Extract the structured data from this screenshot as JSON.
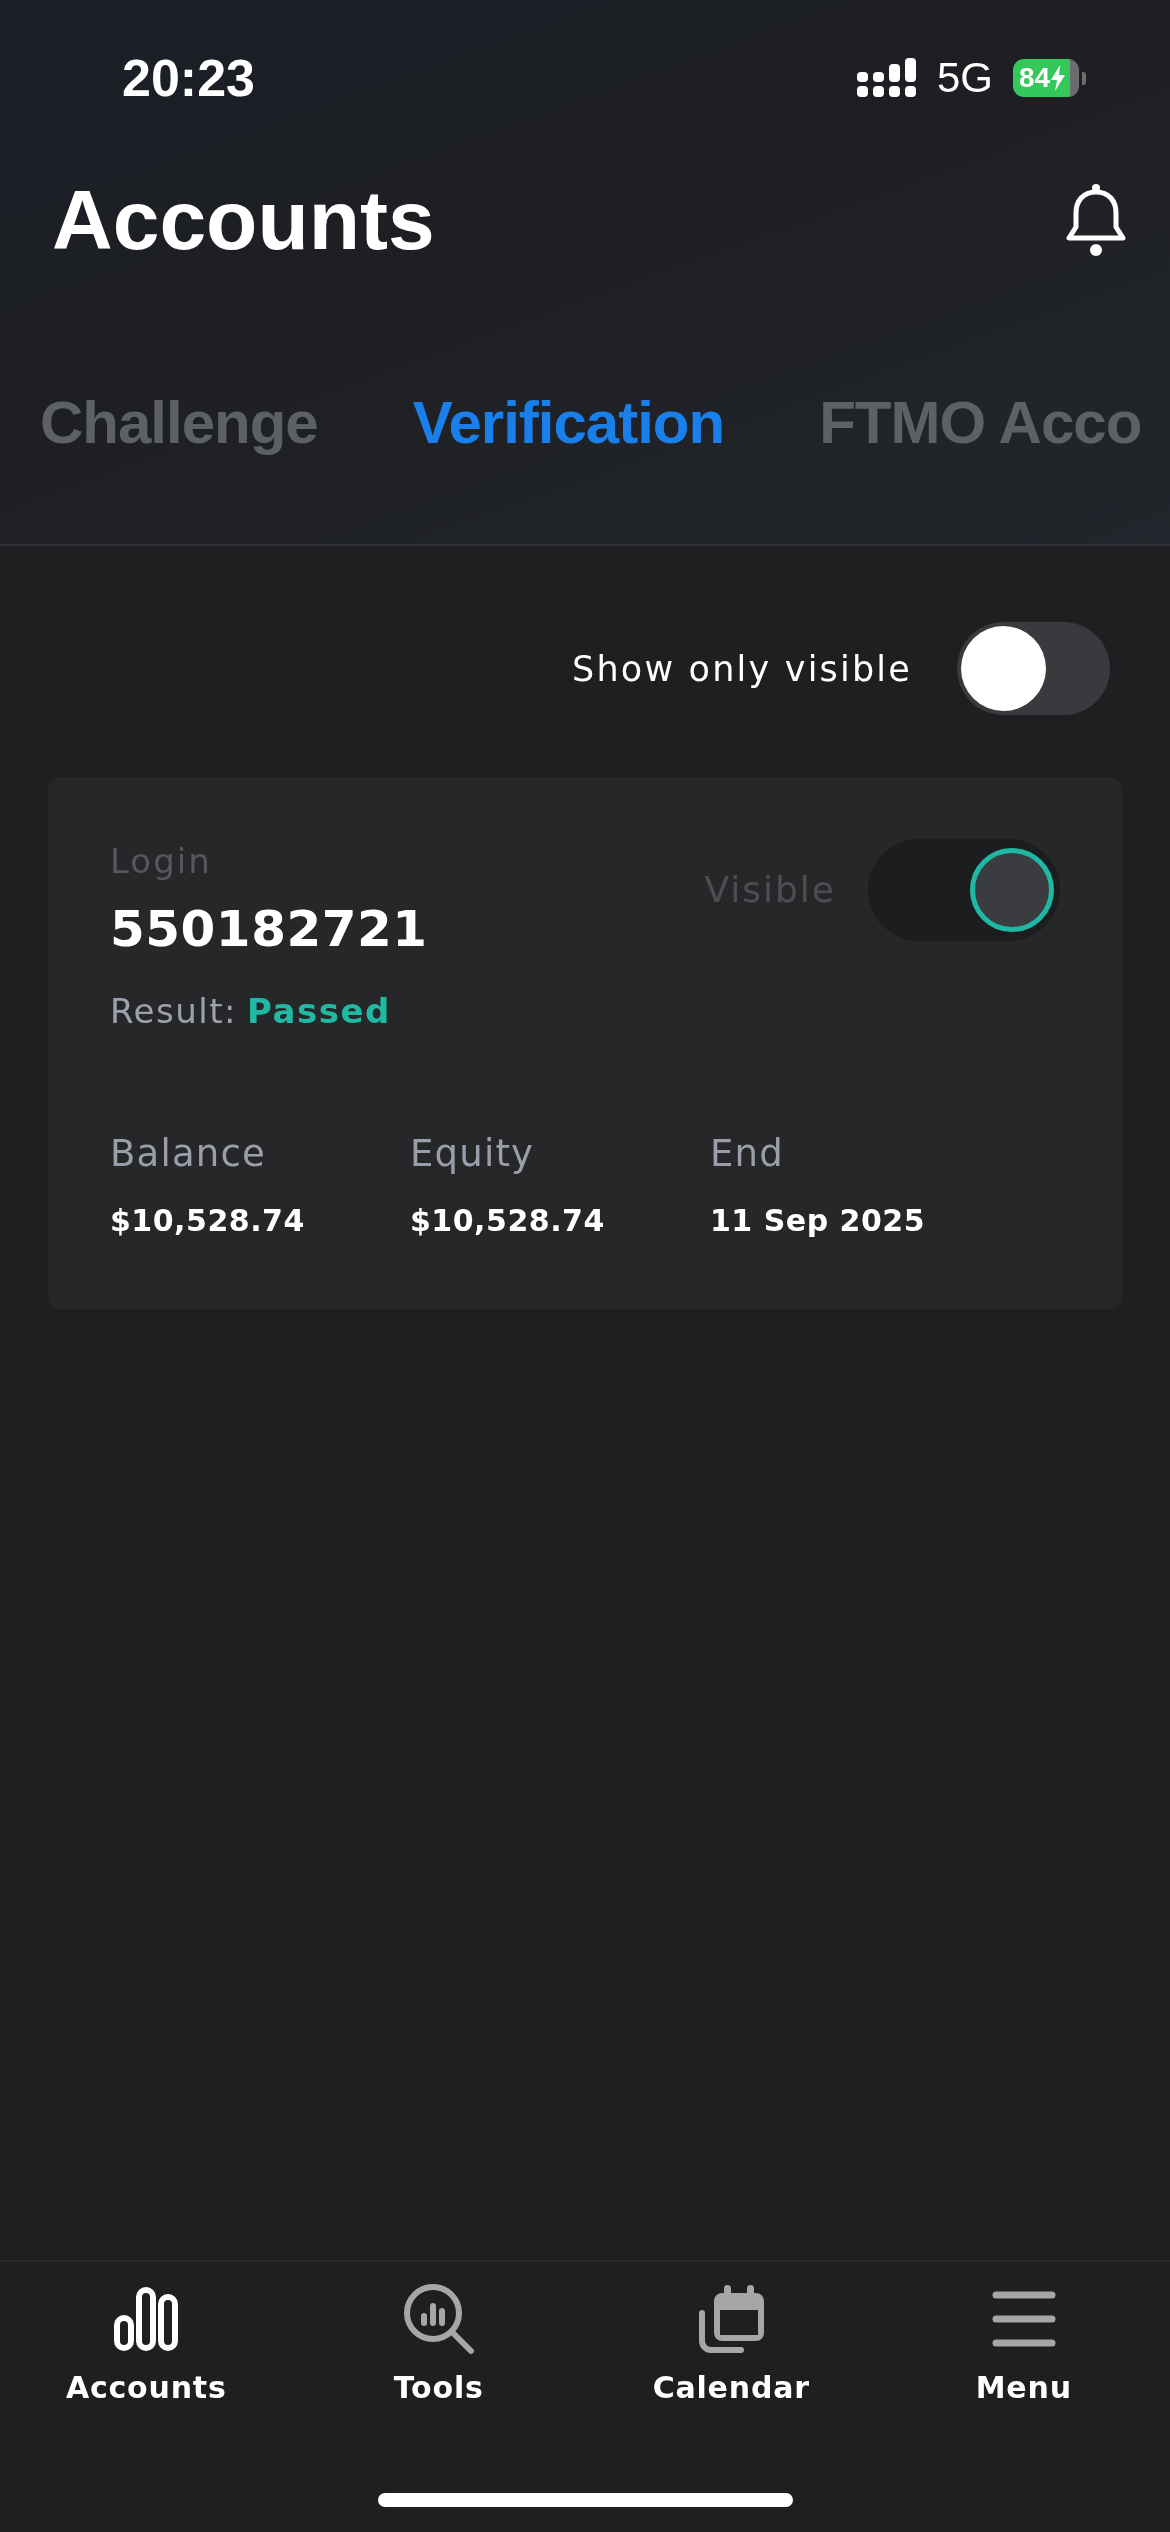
{
  "status_bar": {
    "time": "20:23",
    "network": "5G",
    "battery": "84",
    "charging": true
  },
  "header": {
    "title": "Accounts"
  },
  "tabs": [
    {
      "label": "Challenge",
      "selected": false
    },
    {
      "label": "Verification",
      "selected": true
    },
    {
      "label": "FTMO Acco",
      "selected": false
    }
  ],
  "filter": {
    "label": "Show only visible",
    "on": false
  },
  "accounts": [
    {
      "login_label": "Login",
      "login": "550182721",
      "result_label": "Result:",
      "result": "Passed",
      "visible_label": "Visible",
      "visible": true,
      "stats": [
        {
          "label": "Balance",
          "value": "$10,528.74"
        },
        {
          "label": "Equity",
          "value": "$10,528.74"
        },
        {
          "label": "End",
          "value": "11 Sep 2025"
        }
      ]
    }
  ],
  "nav": [
    {
      "kind": "bars",
      "label": "Accounts",
      "selected": true
    },
    {
      "kind": "search",
      "label": "Tools",
      "selected": false
    },
    {
      "kind": "calendar",
      "label": "Calendar",
      "selected": false
    },
    {
      "kind": "menu",
      "label": "Menu",
      "selected": false
    }
  ]
}
